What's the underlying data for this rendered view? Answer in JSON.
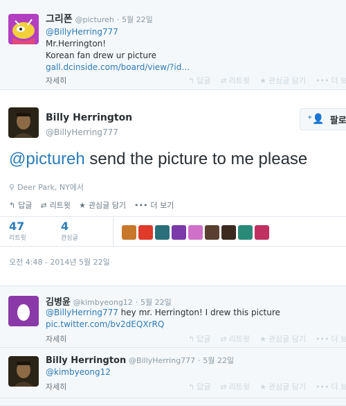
{
  "tweets": {
    "t1": {
      "name": "그리폰",
      "handle": "@pictureh",
      "time": "5월 22일",
      "mention": "@BillyHerring777",
      "line1": "Mr.Herrington!",
      "line2": "Korean fan drew ur picture",
      "link": "gall.dcinside.com/board/view/?id…",
      "expand": "자세히"
    },
    "main": {
      "name": "Billy Herrington",
      "handle": "@BillyHerring777",
      "follow": "팔로",
      "mention": "@pictureh",
      "text": " send the picture to me please",
      "location": "Deer Park, NY에서",
      "timestamp": "오전 4:48 - 2014년 5월 22일",
      "retweets": "47",
      "retweets_label": "리트윗",
      "favorites": "4",
      "favorites_label": "관심글"
    },
    "t2": {
      "name": "김병윤",
      "handle": "@kimbyeong12",
      "time": "5월 22일",
      "mention": "@BillyHerring777",
      "text": " hey mr. Herrington!  I drew this picture",
      "link": "pic.twitter.com/bv2dEQXrRQ",
      "expand": "자세히"
    },
    "t3": {
      "name": "Billy Herrington",
      "handle": "@BillyHerring777",
      "time": "5월 22일",
      "mention": "@kimbyeong12",
      "expand": "자세히"
    }
  },
  "actions": {
    "reply": "답글",
    "retweet": "리트윗",
    "favorite": "관심글 담기",
    "more": "더 보기"
  },
  "colors": {
    "link": "#2b7bb9",
    "muted": "#8899a6",
    "border": "#e1e8ed",
    "light_bg": "#f5f8fa"
  }
}
